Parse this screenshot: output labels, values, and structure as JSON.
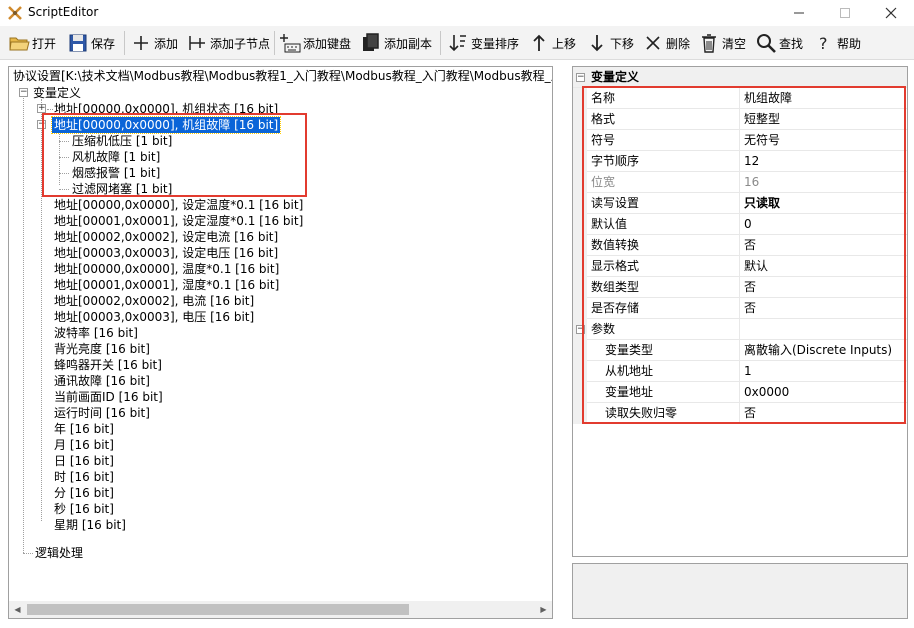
{
  "window": {
    "title": "ScriptEditor"
  },
  "toolbar": {
    "open": "打开",
    "save": "保存",
    "add": "添加",
    "add_child": "添加子节点",
    "add_key": "添加键盘",
    "add_copy": "添加副本",
    "sort_vars": "变量排序",
    "move_up": "上移",
    "move_down": "下移",
    "delete": "删除",
    "clear": "清空",
    "find": "查找",
    "help": "帮助"
  },
  "left": {
    "path": "协议设置[K:\\技术文档\\Modbus教程\\Modbus教程1_入门教程\\Modbus教程_入门教程\\Modbus教程_入",
    "root": "变量定义",
    "nodes": [
      "地址[00000,0x0000], 机组状态 [16 bit]",
      "地址[00000,0x0000], 机组故障 [16 bit]",
      "压缩机低压 [1 bit]",
      "风机故障 [1 bit]",
      "烟感报警 [1 bit]",
      "过滤网堵塞 [1 bit]",
      "地址[00000,0x0000], 设定温度*0.1 [16 bit]",
      "地址[00001,0x0001], 设定湿度*0.1 [16 bit]",
      "地址[00002,0x0002], 设定电流 [16 bit]",
      "地址[00003,0x0003], 设定电压 [16 bit]",
      "地址[00000,0x0000], 温度*0.1 [16 bit]",
      "地址[00001,0x0001], 湿度*0.1 [16 bit]",
      "地址[00002,0x0002], 电流 [16 bit]",
      "地址[00003,0x0003], 电压 [16 bit]",
      "波特率 [16 bit]",
      "背光亮度 [16 bit]",
      "蜂鸣器开关 [16 bit]",
      "通讯故障 [16 bit]",
      "当前画面ID [16 bit]",
      "运行时间 [16 bit]",
      "年 [16 bit]",
      "月 [16 bit]",
      "日 [16 bit]",
      "时 [16 bit]",
      "分 [16 bit]",
      "秒 [16 bit]",
      "星期 [16 bit]"
    ],
    "logic": "逻辑处理"
  },
  "props": {
    "category": "变量定义",
    "rows": [
      {
        "name": "名称",
        "value": "机组故障"
      },
      {
        "name": "格式",
        "value": "短整型"
      },
      {
        "name": "符号",
        "value": "无符号"
      },
      {
        "name": "字节顺序",
        "value": "12"
      },
      {
        "name": "位宽",
        "value": "16"
      },
      {
        "name": "读写设置",
        "value": "只读取"
      },
      {
        "name": "默认值",
        "value": "0"
      },
      {
        "name": "数值转换",
        "value": "否"
      },
      {
        "name": "显示格式",
        "value": "默认"
      },
      {
        "name": "数组类型",
        "value": "否"
      },
      {
        "name": "是否存储",
        "value": "否"
      },
      {
        "name": "参数",
        "value": ""
      },
      {
        "name": "变量类型",
        "value": "离散输入(Discrete Inputs)"
      },
      {
        "name": "从机地址",
        "value": "1"
      },
      {
        "name": "变量地址",
        "value": "0x0000"
      },
      {
        "name": "读取失败归零",
        "value": "否"
      }
    ]
  },
  "colors": {
    "highlight": "#e23b2f",
    "selection": "#0a64d8"
  }
}
